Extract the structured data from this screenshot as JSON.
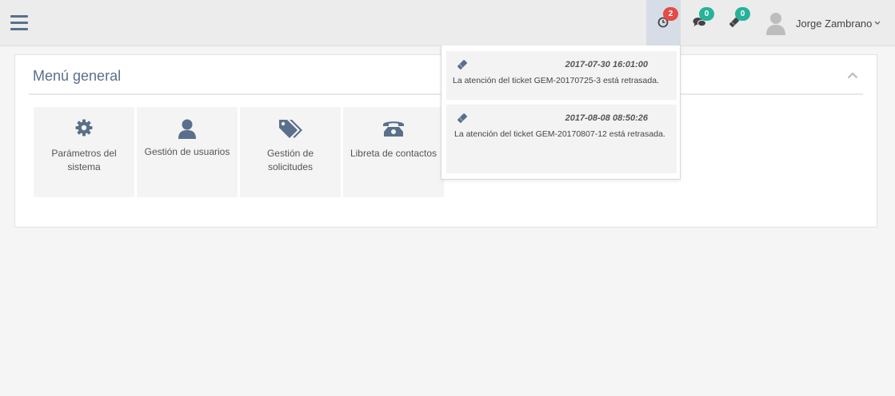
{
  "topbar": {
    "menu_icon": "hamburger-icon",
    "alerts": {
      "icon": "clock-icon",
      "count": "2",
      "color": "#e34c47"
    },
    "messages": {
      "icon": "comments-icon",
      "count": "0",
      "color": "#27b299"
    },
    "tickets": {
      "icon": "ticket-icon",
      "count": "0",
      "color": "#27b299"
    },
    "user": {
      "name": "Jorge Zambrano",
      "avatar_icon": "user-avatar-icon"
    }
  },
  "panel": {
    "title": "Menú general",
    "collapse_icon": "chevron-up-icon",
    "tiles": [
      {
        "icon": "gear-icon",
        "label": "Parámetros del sistema"
      },
      {
        "icon": "user-icon",
        "label": "Gestión de usuarios"
      },
      {
        "icon": "tags-icon",
        "label": "Gestión de solicitudes"
      },
      {
        "icon": "phone-icon",
        "label": "Libreta de contactos"
      }
    ]
  },
  "notifications": [
    {
      "icon": "ticket-icon",
      "time": "2017-07-30 16:01:00",
      "text": "La atención del ticket GEM-20170725-3 está retrasada."
    },
    {
      "icon": "ticket-icon",
      "time": "2017-08-08 08:50:26",
      "text": "La atención del ticket GEM-20170807-12 está retrasada."
    }
  ],
  "colors": {
    "accent": "#5a6f8c",
    "panel_bg": "#ffffff",
    "page_bg": "#f5f5f5"
  }
}
